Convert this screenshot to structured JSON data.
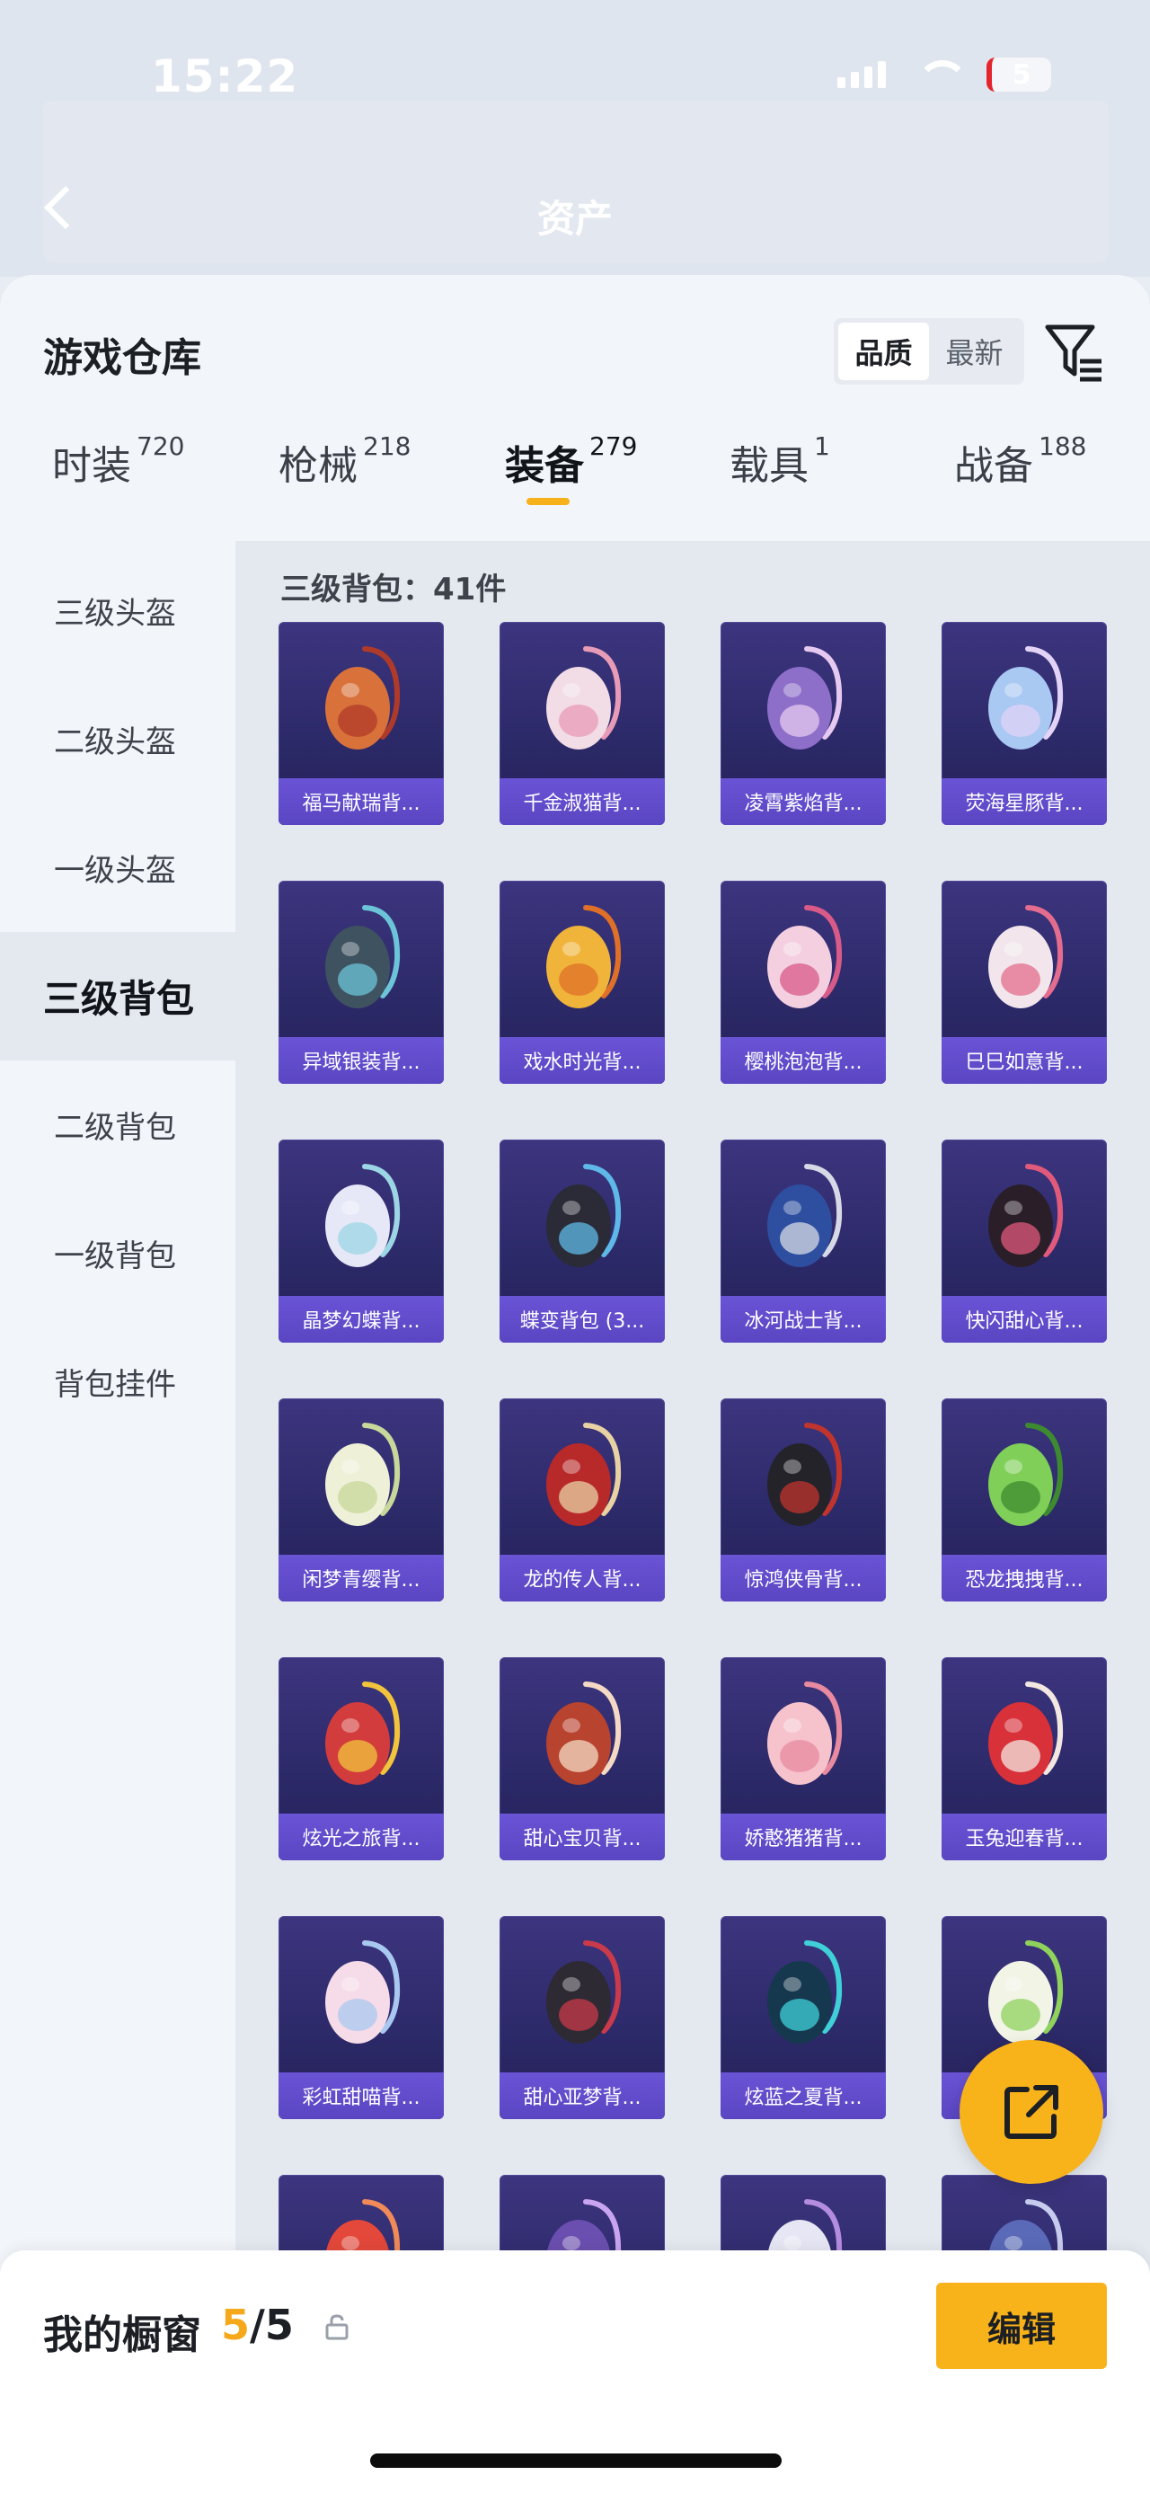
{
  "status_bar": {
    "time": "15:22",
    "battery": "5"
  },
  "nav": {
    "title": "资产"
  },
  "warehouse": {
    "title": "游戏仓库",
    "sort_options": [
      "品质",
      "最新"
    ],
    "active_sort": 0
  },
  "tabs": [
    {
      "label": "时装",
      "count": "720"
    },
    {
      "label": "枪械",
      "count": "218"
    },
    {
      "label": "装备",
      "count": "279"
    },
    {
      "label": "载具",
      "count": "1"
    },
    {
      "label": "战备",
      "count": "188"
    }
  ],
  "active_tab": 2,
  "sidebar": {
    "items": [
      "三级头盔",
      "二级头盔",
      "一级头盔",
      "三级背包",
      "二级背包",
      "一级背包",
      "背包挂件"
    ],
    "active_index": 3
  },
  "section": {
    "title": "三级背包：41件"
  },
  "items": [
    {
      "name": "福马献瑞背...",
      "color": "#d9723a",
      "accent": "#b03a2a"
    },
    {
      "name": "千金淑猫背...",
      "color": "#f2dce6",
      "accent": "#e89bb6"
    },
    {
      "name": "凌霄紫焰背...",
      "color": "#8d6ec8",
      "accent": "#e6c9f0"
    },
    {
      "name": "荧海星豚背...",
      "color": "#a9c8f2",
      "accent": "#e2d3f7"
    },
    {
      "name": "异域银装背...",
      "color": "#3f5260",
      "accent": "#6cc4d8"
    },
    {
      "name": "戏水时光背...",
      "color": "#f0b43a",
      "accent": "#e07028"
    },
    {
      "name": "樱桃泡泡背...",
      "color": "#f4cfe0",
      "accent": "#d85a88"
    },
    {
      "name": "巳巳如意背...",
      "color": "#f2e6ec",
      "accent": "#e46c8e"
    },
    {
      "name": "晶梦幻蝶背...",
      "color": "#e6e8f8",
      "accent": "#9cd6e4"
    },
    {
      "name": "蝶变背包 (3...",
      "color": "#2a2b36",
      "accent": "#5fb9e8"
    },
    {
      "name": "冰河战士背...",
      "color": "#2e4fa0",
      "accent": "#d7d9e6"
    },
    {
      "name": "快闪甜心背...",
      "color": "#2a1e28",
      "accent": "#e05a7c"
    },
    {
      "name": "闲梦青缨背...",
      "color": "#eef0d8",
      "accent": "#c7d89a"
    },
    {
      "name": "龙的传人背...",
      "color": "#b82a2a",
      "accent": "#e8d2a4"
    },
    {
      "name": "惊鸿侠骨背...",
      "color": "#24232a",
      "accent": "#c0342e"
    },
    {
      "name": "恐龙拽拽背...",
      "color": "#7fcf58",
      "accent": "#3e8a30"
    },
    {
      "name": "炫光之旅背...",
      "color": "#d33c3c",
      "accent": "#f2c43c"
    },
    {
      "name": "甜心宝贝背...",
      "color": "#b8432e",
      "accent": "#f4d9c4"
    },
    {
      "name": "娇憨猪猪背...",
      "color": "#f6c2cc",
      "accent": "#e88aa0"
    },
    {
      "name": "玉兔迎春背...",
      "color": "#d8313a",
      "accent": "#f3e7e2"
    },
    {
      "name": "彩虹甜喵背...",
      "color": "#f6dbe8",
      "accent": "#a9c8f0"
    },
    {
      "name": "甜心亚梦背...",
      "color": "#2d2a33",
      "accent": "#c93a4a"
    },
    {
      "name": "炫蓝之夏背...",
      "color": "#16384f",
      "accent": "#3fd0d8"
    },
    {
      "name": "",
      "color": "#f2f4e6",
      "accent": "#8fd25c"
    },
    {
      "name": "",
      "color": "#e4483a",
      "accent": "#f08a58"
    },
    {
      "name": "",
      "color": "#6b4fb0",
      "accent": "#c9a4f0"
    },
    {
      "name": "",
      "color": "#e6e6f4",
      "accent": "#b48ce0"
    },
    {
      "name": "",
      "color": "#5a6ab8",
      "accent": "#c7ccee"
    }
  ],
  "showcase": {
    "label": "我的橱窗",
    "count_current": "5",
    "count_sep": "/5",
    "edit_label": "编辑"
  },
  "icons": {
    "back": "chevron-left-icon",
    "filter": "filter-icon",
    "share": "share-icon",
    "lock": "lock-icon"
  },
  "colors": {
    "accent": "#f8b21a",
    "card_bg": "#2d2a6a",
    "name_bar": "#5a45c2"
  }
}
